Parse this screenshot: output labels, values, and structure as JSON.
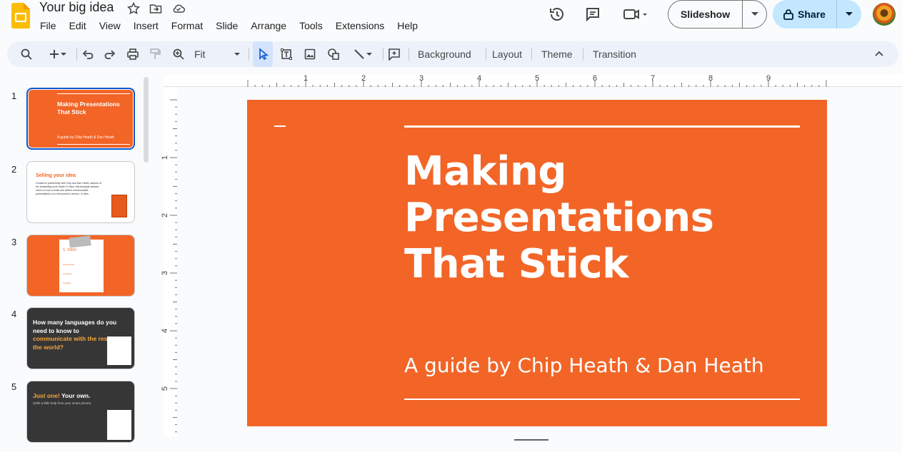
{
  "app": {
    "doc_title": "Your big idea",
    "menu": [
      "File",
      "Edit",
      "View",
      "Insert",
      "Format",
      "Slide",
      "Arrange",
      "Tools",
      "Extensions",
      "Help"
    ],
    "slideshow_label": "Slideshow",
    "share_label": "Share"
  },
  "toolbar": {
    "zoom_value": "Fit",
    "background_label": "Background",
    "layout_label": "Layout",
    "theme_label": "Theme",
    "transition_label": "Transition"
  },
  "ruler": {
    "h_marks": [
      "1",
      "2",
      "3",
      "4",
      "5",
      "6",
      "7",
      "8",
      "9"
    ],
    "v_marks": [
      "1",
      "2",
      "3",
      "4",
      "5"
    ]
  },
  "slides": [
    {
      "num": "1",
      "title": "Making Presentations That Stick",
      "subtitle": "A guide by Chip Heath & Dan Heath",
      "bg": "#f26527"
    },
    {
      "num": "2",
      "title": "Selling your idea",
      "body": "Created in partnership with Chip and Dan Heath, authors of the bestselling book Made To Stick, this template advises users on how to build and deliver unmemorable presentations of a new product, service, or idea.",
      "bg": "#ffffff"
    },
    {
      "num": "3",
      "title": "1. Intro",
      "items": [
        "Unexpected",
        "Concrete",
        "Credible"
      ],
      "bg": "#f26527"
    },
    {
      "num": "4",
      "line1": "How many languages do you need to know to",
      "line2": "communicate with the rest of the world?",
      "bg": "#363636"
    },
    {
      "num": "5",
      "hl": "Just one!",
      "rest": "Your own.",
      "sub": "(With a little help from your smart phone)",
      "bg": "#363636"
    }
  ],
  "main_slide": {
    "title": "Making Presentations That Stick",
    "subtitle": "A guide by Chip Heath & Dan Heath",
    "bg": "#f26527"
  },
  "colors": {
    "accent": "#f26527",
    "selection": "#0b57d0",
    "share_bg": "#c2e7ff"
  }
}
